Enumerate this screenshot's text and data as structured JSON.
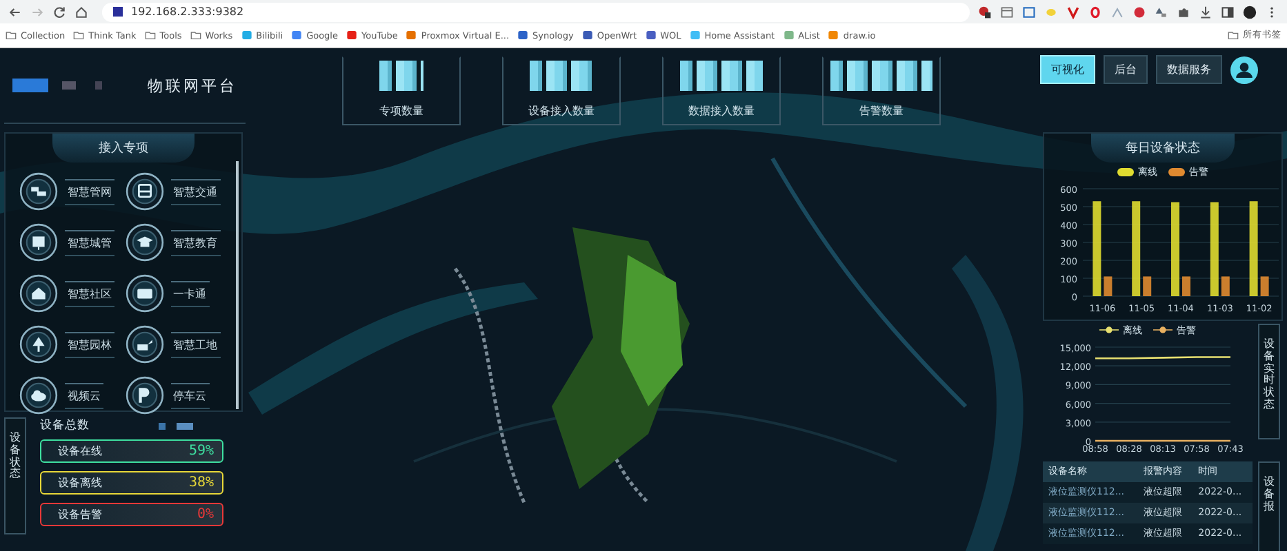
{
  "browser": {
    "url": "192.168.2.333:9382",
    "bookmarks": [
      {
        "label": "Collection",
        "kind": "folder"
      },
      {
        "label": "Think Tank",
        "kind": "folder"
      },
      {
        "label": "Tools",
        "kind": "folder"
      },
      {
        "label": "Works",
        "kind": "folder"
      },
      {
        "label": "Bilibili",
        "kind": "site",
        "color": "#23ade5"
      },
      {
        "label": "Google",
        "kind": "site",
        "color": "#4285f4"
      },
      {
        "label": "YouTube",
        "kind": "site",
        "color": "#e62117"
      },
      {
        "label": "Proxmox Virtual E...",
        "kind": "site",
        "color": "#e57000"
      },
      {
        "label": "Synology",
        "kind": "site",
        "color": "#2c63c8"
      },
      {
        "label": "OpenWrt",
        "kind": "site",
        "color": "#3b5bb5"
      },
      {
        "label": "WOL",
        "kind": "site",
        "color": "#4a5fc1"
      },
      {
        "label": "Home Assistant",
        "kind": "site",
        "color": "#41bdf5"
      },
      {
        "label": "AList",
        "kind": "site",
        "color": "#7fb88a"
      },
      {
        "label": "draw.io",
        "kind": "site",
        "color": "#f08705"
      }
    ],
    "all_bookmarks": "所有书签"
  },
  "header": {
    "title": "物联网平台"
  },
  "stats": [
    {
      "label": "专项数量"
    },
    {
      "label": "设备接入数量"
    },
    {
      "label": "数据接入数量"
    },
    {
      "label": "告警数量"
    }
  ],
  "nav": [
    {
      "label": "可视化",
      "selected": true
    },
    {
      "label": "后台",
      "selected": false
    },
    {
      "label": "数据服务",
      "selected": false
    }
  ],
  "access_panel": {
    "title": "接入专项",
    "items": [
      "智慧管网",
      "智慧交通",
      "智慧城管",
      "智慧教育",
      "智慧社区",
      "一卡通",
      "智慧园林",
      "智慧工地",
      "视频云",
      "停车云"
    ]
  },
  "device_status": {
    "tab": "设备状态",
    "title": "设备总数",
    "rows": [
      {
        "label": "设备在线",
        "value": "59%",
        "color": "#3ee0a0"
      },
      {
        "label": "设备离线",
        "value": "38%",
        "color": "#e8d838"
      },
      {
        "label": "设备告警",
        "value": "0%",
        "color": "#e83838"
      }
    ]
  },
  "daily_chart": {
    "title": "每日设备状态",
    "chart_data": {
      "type": "bar",
      "grid": true,
      "categories": [
        "11-06",
        "11-05",
        "11-04",
        "11-03",
        "11-02"
      ],
      "ylim": [
        0,
        600
      ],
      "yticks": [
        0,
        100,
        200,
        300,
        400,
        500,
        600
      ],
      "series": [
        {
          "name": "离线",
          "color": "#e0dc30",
          "values": [
            530,
            530,
            525,
            525,
            530
          ]
        },
        {
          "name": "告警",
          "color": "#e08a30",
          "values": [
            110,
            110,
            110,
            110,
            110
          ]
        }
      ]
    }
  },
  "realtime": {
    "tab": "设备实时状态",
    "chart_data": {
      "type": "line",
      "grid": true,
      "x": [
        "08:58",
        "08:28",
        "08:13",
        "07:58",
        "07:43"
      ],
      "ylim": [
        0,
        15000
      ],
      "yticks": [
        {
          "value": 0,
          "label": "0"
        },
        {
          "value": 3000,
          "label": "3,000"
        },
        {
          "value": 6000,
          "label": "6,000"
        },
        {
          "value": 9000,
          "label": "9,000"
        },
        {
          "value": 12000,
          "label": "12,000"
        },
        {
          "value": 15000,
          "label": "15,000"
        }
      ],
      "series": [
        {
          "name": "离线",
          "color": "#e8e070",
          "values": [
            13200,
            13200,
            13300,
            13400,
            13400
          ]
        },
        {
          "name": "告警",
          "color": "#e8b060",
          "values": [
            0,
            0,
            0,
            0,
            0
          ]
        }
      ]
    }
  },
  "alarms": {
    "tab": "设备报",
    "columns": [
      "设备名称",
      "报警内容",
      "时间"
    ],
    "rows": [
      [
        "液位监测仪112...",
        "液位超限",
        "2022-0..."
      ],
      [
        "液位监测仪112...",
        "液位超限",
        "2022-0..."
      ],
      [
        "液位监测仪112...",
        "液位超限",
        "2022-0..."
      ]
    ]
  }
}
